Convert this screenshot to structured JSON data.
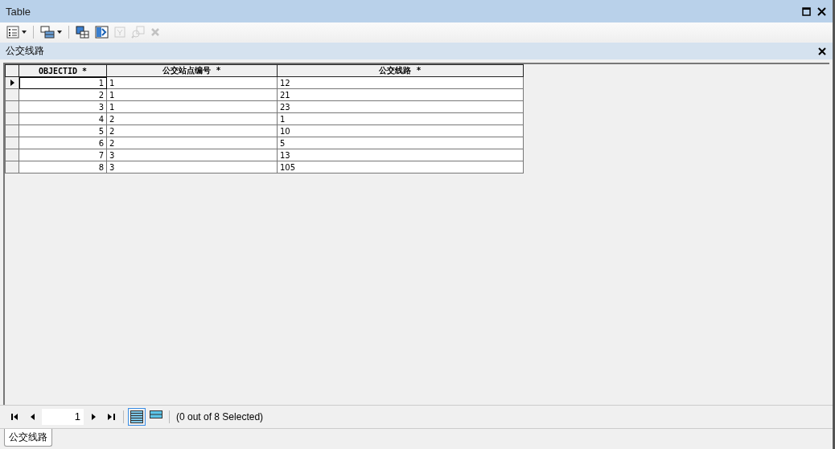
{
  "window": {
    "title": "Table"
  },
  "toolbar": [
    {
      "kind": "table-options",
      "disabled": false,
      "dropdown": true
    },
    {
      "kind": "related-tables",
      "disabled": false,
      "dropdown": true
    },
    {
      "kind": "select-by-attributes",
      "disabled": false,
      "dropdown": false
    },
    {
      "kind": "switch-selection",
      "disabled": false,
      "dropdown": false
    },
    {
      "kind": "clear-selection",
      "disabled": true,
      "dropdown": false
    },
    {
      "kind": "zoom-to-selected",
      "disabled": true,
      "dropdown": false
    },
    {
      "kind": "delete-selected",
      "disabled": true,
      "dropdown": false
    }
  ],
  "table_title": "公交线路",
  "table": {
    "columns": [
      "OBJECTID *",
      "公交站点编号 *",
      "公交线路 *"
    ],
    "rows": [
      {
        "current": true,
        "cells": [
          "1",
          "1",
          "12"
        ]
      },
      {
        "current": false,
        "cells": [
          "2",
          "1",
          "21"
        ]
      },
      {
        "current": false,
        "cells": [
          "3",
          "1",
          "23"
        ]
      },
      {
        "current": false,
        "cells": [
          "4",
          "2",
          "1"
        ]
      },
      {
        "current": false,
        "cells": [
          "5",
          "2",
          "10"
        ]
      },
      {
        "current": false,
        "cells": [
          "6",
          "2",
          "5"
        ]
      },
      {
        "current": false,
        "cells": [
          "7",
          "3",
          "13"
        ]
      },
      {
        "current": false,
        "cells": [
          "8",
          "3",
          "105"
        ]
      }
    ]
  },
  "navigator": {
    "record": "1",
    "views": [
      {
        "kind": "all",
        "selected": true
      },
      {
        "kind": "selected",
        "selected": false
      }
    ],
    "status": "(0 out of 8 Selected)"
  },
  "tabs": [
    {
      "label": "公交线路",
      "selected": true
    }
  ]
}
